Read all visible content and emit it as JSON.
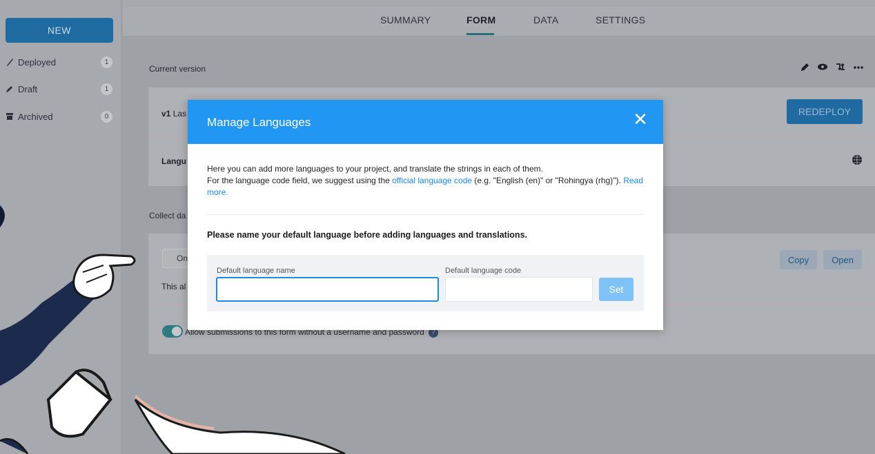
{
  "sidebar": {
    "new_label": "NEW",
    "items": [
      {
        "label": "Deployed",
        "count": "1",
        "icon": "rocket-icon"
      },
      {
        "label": "Draft",
        "count": "1",
        "icon": "pencil-icon"
      },
      {
        "label": "Archived",
        "count": "0",
        "icon": "archive-icon"
      }
    ]
  },
  "tabs": [
    "SUMMARY",
    "FORM",
    "DATA",
    "SETTINGS"
  ],
  "active_tab": "FORM",
  "main": {
    "current_version_label": "Current version",
    "version_prefix": "v1",
    "version_text": "Las",
    "redeploy_label": "REDEPLOY",
    "languages_label": "Langu",
    "collect_label": "Collect da",
    "online_label": "Onli",
    "this_label": "This al",
    "copy_label": "Copy",
    "open_label": "Open",
    "allow_text": "Allow submissions to this form without a username and password",
    "help_glyph": "?"
  },
  "modal": {
    "title": "Manage Languages",
    "close_glyph": "✕",
    "intro_line1": "Here you can add more languages to your project, and translate the strings in each of them.",
    "intro_line2_before": "For the language code field, we suggest using the ",
    "intro_link": "official language code",
    "intro_line2_after": " (e.g. \"English (en)\" or \"Rohingya (rhg)\"). ",
    "read_more": "Read more.",
    "warning": "Please name your default language before adding languages and translations.",
    "name_label": "Default language name",
    "code_label": "Default language code",
    "name_value": "",
    "code_value": "",
    "set_label": "Set"
  },
  "colors": {
    "modal_header": "#2196f3",
    "link": "#1e88e5",
    "set_button": "#7ec2f7",
    "primary_button": "#1f6aa0"
  }
}
